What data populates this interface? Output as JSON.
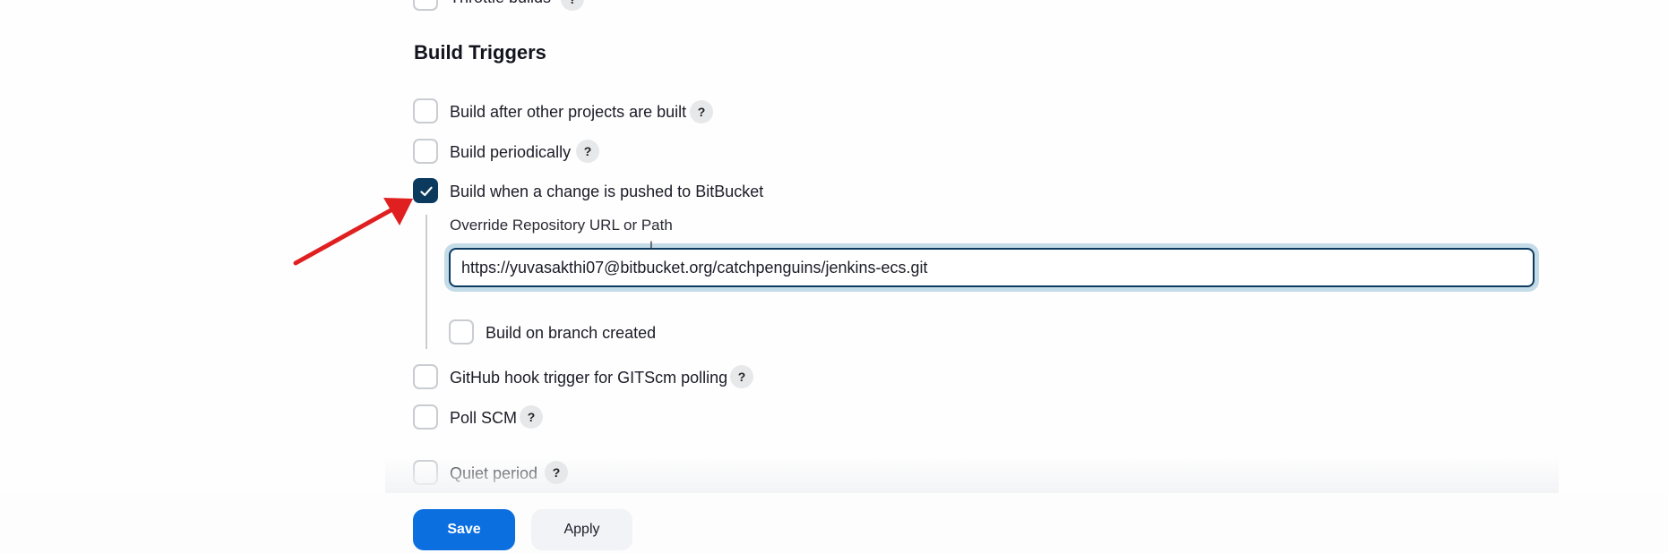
{
  "previous_item": {
    "label": "Throttle builds",
    "checked": false
  },
  "section": {
    "title": "Build Triggers"
  },
  "triggers": [
    {
      "label": "Build after other projects are built",
      "checked": false,
      "help": "?"
    },
    {
      "label": "Build periodically",
      "checked": false,
      "help": "?"
    },
    {
      "label": "Build when a change is pushed to BitBucket",
      "checked": true
    }
  ],
  "bitbucket_options": {
    "override_label": "Override Repository URL or Path",
    "override_value": "https://yuvasakthi07@bitbucket.org/catchpenguins/jenkins-ecs.git",
    "branch_created_label": "Build on branch created",
    "branch_created_checked": false
  },
  "more_triggers": [
    {
      "label": "GitHub hook trigger for GITScm polling",
      "checked": false,
      "help": "?"
    },
    {
      "label": "Poll SCM",
      "checked": false,
      "help": "?"
    },
    {
      "label": "Quiet period",
      "checked": false,
      "help": "?"
    }
  ],
  "footer": {
    "save_label": "Save",
    "apply_label": "Apply"
  },
  "colors": {
    "accent": "#0b6fe0",
    "checkbox_checked": "#0c3a5e",
    "annotation_arrow": "#e02020"
  }
}
